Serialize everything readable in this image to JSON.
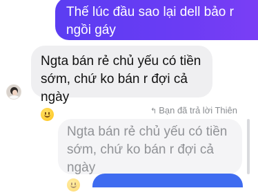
{
  "messages": {
    "outgoing_1": "Thế lúc đầu sao lại dell bảo r ngồi gáy",
    "incoming_1": "Ngta bán rẻ chủ yếu có tiền sớm, chứ ko bán r đợi cả ngày",
    "reply_label": "Bạn đã trả lời Thiên",
    "quoted_reply": "Ngta bán rẻ chủ yếu có tiền sớm, chứ ko bán r đợi cả ngày"
  },
  "icons": {
    "reply": "reply-arrow-icon",
    "emoji": "slightly-smiling-face-emoji"
  },
  "colors": {
    "outgoing": "#6a3cf4",
    "incoming": "#efeff1",
    "next_outgoing": "#3f6cf0"
  }
}
